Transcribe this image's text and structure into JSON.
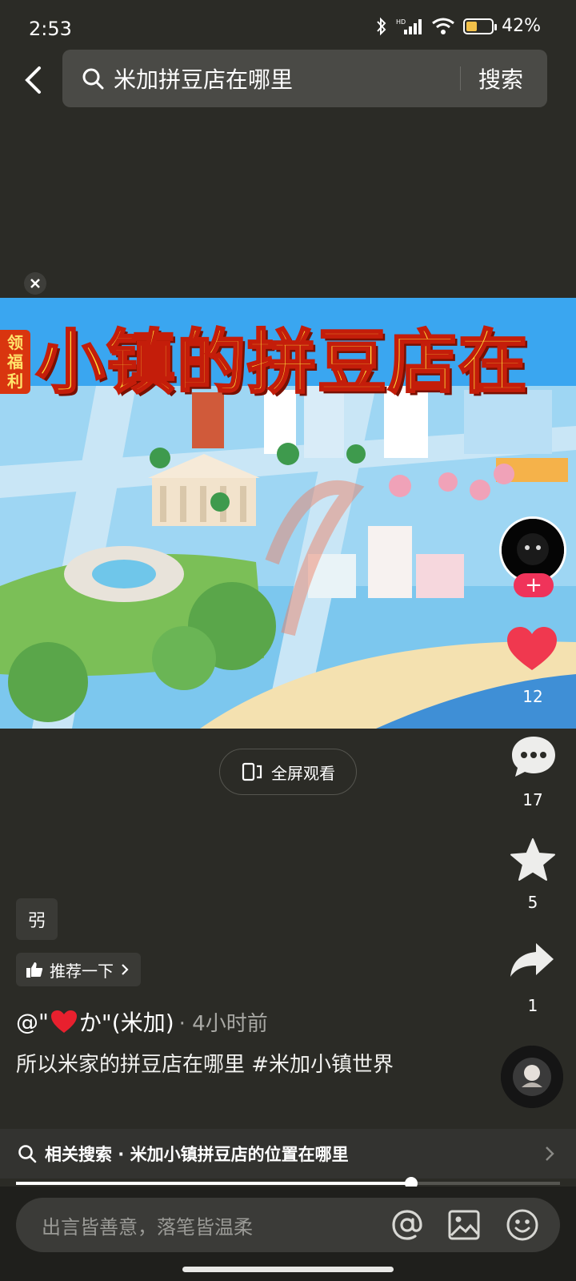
{
  "status": {
    "time": "2:53",
    "battery": "42%",
    "battery_level": 0.42,
    "network": "HD"
  },
  "search": {
    "query": "米加拼豆店在哪里",
    "button": "搜索"
  },
  "video": {
    "banner_text": "小镇的拼豆店在",
    "side_badge": "领福利",
    "progress": 0.727
  },
  "fullscreen": {
    "label": "全屏观看"
  },
  "rail": {
    "likes": "12",
    "comments": "17",
    "favorites": "5",
    "shares": "1"
  },
  "post": {
    "tag_chip": "弜",
    "recommend": "推荐一下",
    "author_prefix": "@\"",
    "author_suffix": "か\"(米加)",
    "time": "· 4小时前",
    "caption": "所以米家的拼豆店在哪里 #米加小镇世界"
  },
  "related": {
    "label": "相关搜索 · 米加小镇拼豆店的位置在哪里"
  },
  "comment": {
    "placeholder": "出言皆善意，落笔皆温柔"
  },
  "colors": {
    "accent": "#f0335a",
    "background": "#2b2b26"
  }
}
